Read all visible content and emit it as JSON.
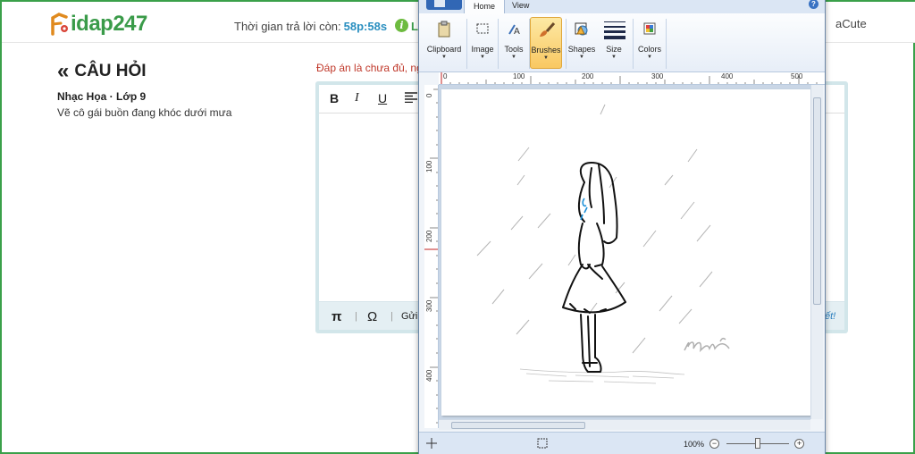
{
  "site": {
    "logo_text": "idap247",
    "timer_label": "Thời gian trả lời còn:",
    "timer_value": "58p:58s",
    "info_text": "L",
    "user_name": "aCute"
  },
  "question": {
    "back_title": "CÂU HỎI",
    "subject": "Nhạc Họa · Lớp 9",
    "text": "Vẽ cô gái buồn đang khóc dưới mưa"
  },
  "editor": {
    "warning": "Đáp án là chưa đủ, ng",
    "bold": "B",
    "italic": "I",
    "underline": "U",
    "pi": "π",
    "omega": "Ω",
    "send_label": "Gửi",
    "footer_link": "ết!"
  },
  "paint": {
    "tabs": [
      "Home",
      "View"
    ],
    "active_tab": "Home",
    "groups": [
      "Clipboard",
      "Image",
      "Tools",
      "Brushes",
      "Shapes",
      "Size",
      "Colors"
    ],
    "selected_group": "Brushes",
    "ruler_top": [
      "0",
      "100",
      "200",
      "300",
      "400",
      "500"
    ],
    "ruler_left": [
      "0",
      "100",
      "200",
      "300",
      "400"
    ],
    "canvas_signature": "Mưa",
    "zoom": "100%",
    "accent_color": "#f9c862"
  }
}
